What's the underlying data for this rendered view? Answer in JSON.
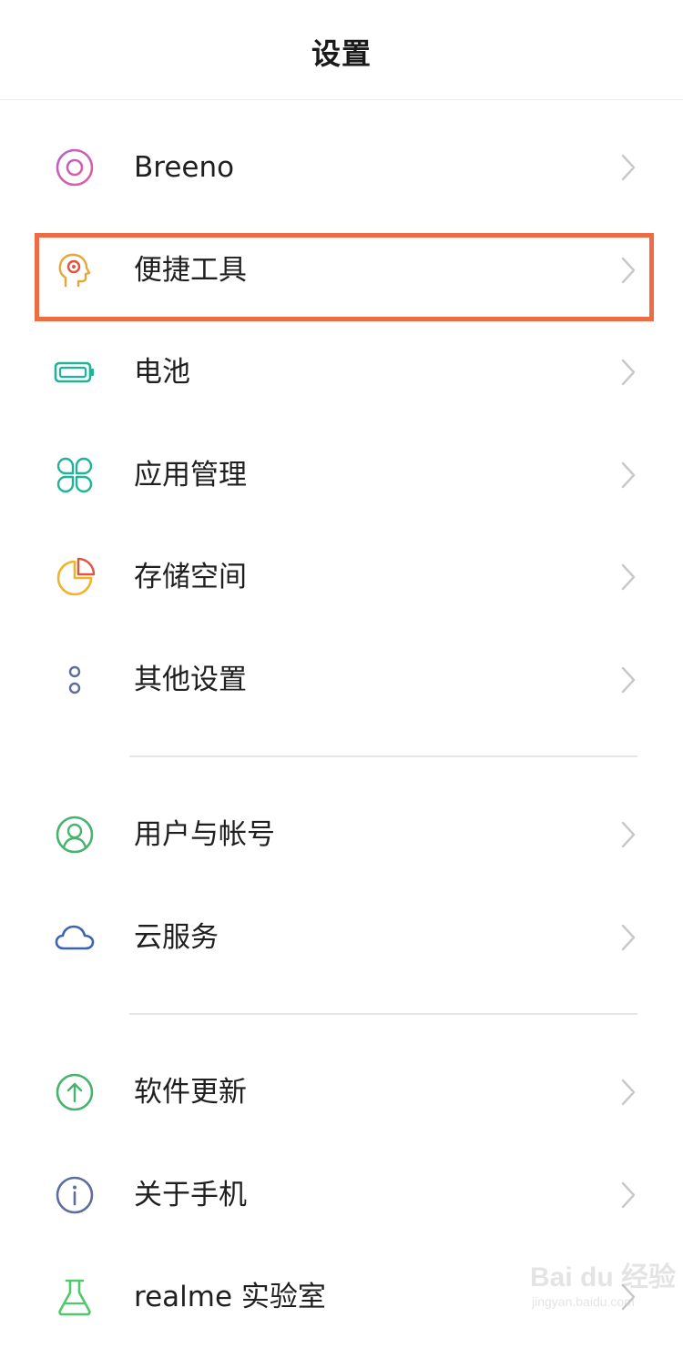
{
  "header": {
    "title": "设置"
  },
  "items": [
    {
      "label": "Breeno",
      "icon": "breeno-icon",
      "color": "#c85fb8"
    },
    {
      "label": "便捷工具",
      "icon": "convenience-tools-icon",
      "color": "#e6a63a"
    },
    {
      "label": "电池",
      "icon": "battery-icon",
      "color": "#1fb39a"
    },
    {
      "label": "应用管理",
      "icon": "app-management-icon",
      "color": "#1fb39a"
    },
    {
      "label": "存储空间",
      "icon": "storage-icon",
      "color": "#f0b429"
    },
    {
      "label": "其他设置",
      "icon": "other-settings-icon",
      "color": "#5d6e9e"
    },
    {
      "label": "用户与帐号",
      "icon": "user-account-icon",
      "color": "#46b36e"
    },
    {
      "label": "云服务",
      "icon": "cloud-icon",
      "color": "#3b62b5"
    },
    {
      "label": "软件更新",
      "icon": "software-update-icon",
      "color": "#46b36e"
    },
    {
      "label": "关于手机",
      "icon": "about-phone-icon",
      "color": "#5d6e9e"
    },
    {
      "label": "realme 实验室",
      "icon": "lab-flask-icon",
      "color": "#4fc96a"
    }
  ],
  "highlight_color": "#ee6c44",
  "watermark": {
    "main": "Bai du 经验",
    "sub": "jingyan.baidu.com"
  }
}
